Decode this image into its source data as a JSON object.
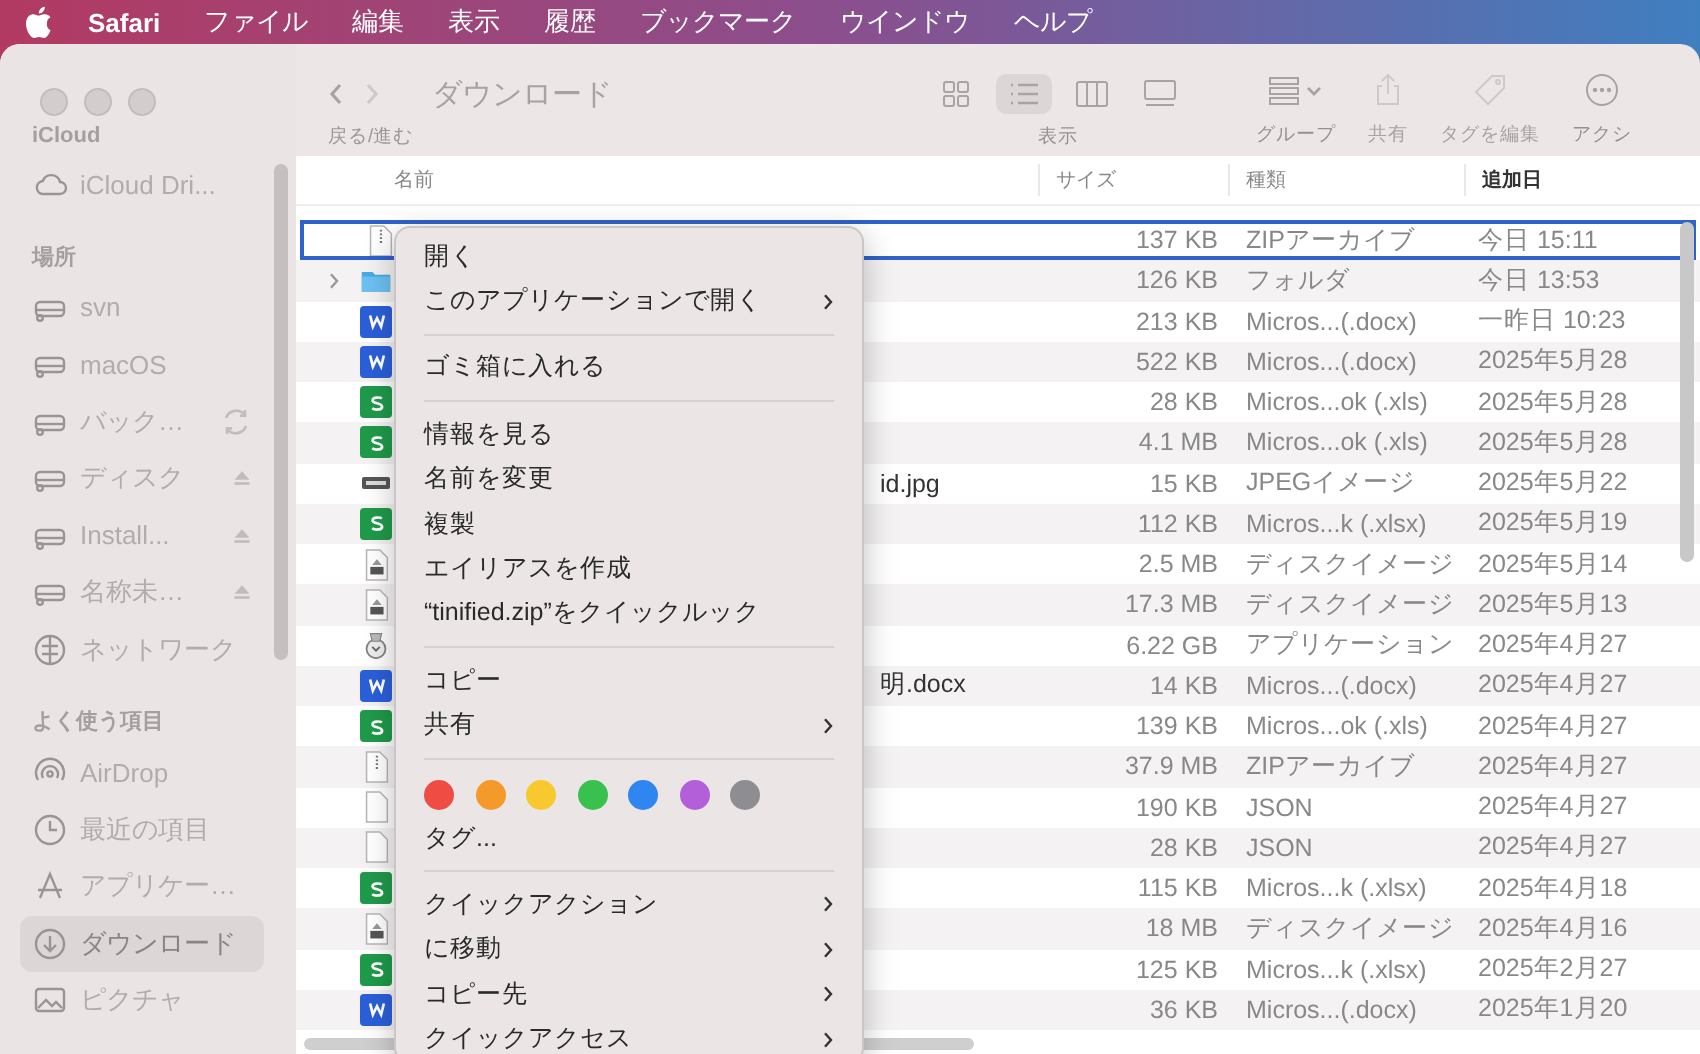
{
  "menu_bar": {
    "app": "Safari",
    "items": [
      "ファイル",
      "編集",
      "表示",
      "履歴",
      "ブックマーク",
      "ウインドウ",
      "ヘルプ"
    ]
  },
  "toolbar": {
    "title": "ダウンロード",
    "nav_label": "戻る/進む",
    "view_label": "表示",
    "views": [
      {
        "kind": "grid",
        "selected": false
      },
      {
        "kind": "list",
        "selected": true
      },
      {
        "kind": "columns",
        "selected": false
      },
      {
        "kind": "gallery",
        "selected": false
      }
    ],
    "actions": [
      {
        "kind": "group",
        "label": "グループ"
      },
      {
        "kind": "share",
        "label": "共有"
      },
      {
        "kind": "tag",
        "label": "タグを編集"
      },
      {
        "kind": "action",
        "label": "アクシ"
      }
    ]
  },
  "sidebar": {
    "sections": [
      {
        "title": "iCloud",
        "items": [
          {
            "label": "iCloud Dri...",
            "kind": "cloud",
            "selected": false
          }
        ]
      },
      {
        "title": "場所",
        "items": [
          {
            "label": "svn",
            "kind": "drive",
            "syncing": false,
            "ejectable": false,
            "selected": false
          },
          {
            "label": "macOS",
            "kind": "drive",
            "syncing": false,
            "ejectable": false,
            "selected": false
          },
          {
            "label": "バック…",
            "kind": "drive",
            "syncing": true,
            "ejectable": false,
            "selected": false
          },
          {
            "label": "ディスク",
            "kind": "drive",
            "syncing": false,
            "ejectable": true,
            "selected": false
          },
          {
            "label": "Install...",
            "kind": "drive",
            "syncing": false,
            "ejectable": true,
            "selected": false
          },
          {
            "label": "名称未…",
            "kind": "drive",
            "syncing": false,
            "ejectable": true,
            "selected": false
          },
          {
            "label": "ネットワーク",
            "kind": "network",
            "syncing": false,
            "ejectable": false,
            "selected": false
          }
        ]
      },
      {
        "title": "よく使う項目",
        "items": [
          {
            "label": "AirDrop",
            "kind": "airdrop",
            "selected": false
          },
          {
            "label": "最近の項目",
            "kind": "clock",
            "selected": false
          },
          {
            "label": "アプリケー…",
            "kind": "apps",
            "selected": false
          },
          {
            "label": "ダウンロード",
            "kind": "download",
            "selected": true
          },
          {
            "label": "ピクチャ",
            "kind": "picture",
            "selected": false
          }
        ]
      }
    ]
  },
  "table": {
    "columns": [
      {
        "label": "名前",
        "sorted": false
      },
      {
        "label": "サイズ",
        "sorted": false
      },
      {
        "label": "種類",
        "sorted": false
      },
      {
        "label": "追加日",
        "sorted": true
      }
    ],
    "rows": [
      {
        "kind": "zip",
        "size": "137 KB",
        "type": "ZIPアーカイブ",
        "date": "今日 15:11",
        "selected": true
      },
      {
        "kind": "folder",
        "size": "126 KB",
        "type": "フォルダ",
        "date": "今日 13:53",
        "selected": false
      },
      {
        "kind": "word",
        "size": "213 KB",
        "type": "Micros...(.docx)",
        "date": "一昨日 10:23",
        "selected": false
      },
      {
        "kind": "word",
        "size": "522 KB",
        "type": "Micros...(.docx)",
        "date": "2025年5月28",
        "selected": false
      },
      {
        "kind": "excel",
        "size": "28 KB",
        "type": "Micros...ok (.xls)",
        "date": "2025年5月28",
        "selected": false
      },
      {
        "kind": "excel",
        "size": "4.1 MB",
        "type": "Micros...ok (.xls)",
        "date": "2025年5月28",
        "selected": false
      },
      {
        "kind": "image",
        "name": "id.jpg",
        "size": "15 KB",
        "type": "JPEGイメージ",
        "date": "2025年5月22",
        "selected": false
      },
      {
        "kind": "excel",
        "size": "112 KB",
        "type": "Micros...k (.xlsx)",
        "date": "2025年5月19",
        "selected": false
      },
      {
        "kind": "disk",
        "size": "2.5 MB",
        "type": "ディスクイメージ",
        "date": "2025年5月14",
        "selected": false
      },
      {
        "kind": "disk",
        "size": "17.3 MB",
        "type": "ディスクイメージ",
        "date": "2025年5月13",
        "selected": false
      },
      {
        "kind": "app",
        "size": "6.22 GB",
        "type": "アプリケーション",
        "date": "2025年4月27",
        "selected": false
      },
      {
        "kind": "word",
        "name": "明.docx",
        "size": "14 KB",
        "type": "Micros...(.docx)",
        "date": "2025年4月27",
        "selected": false
      },
      {
        "kind": "excel",
        "size": "139 KB",
        "type": "Micros...ok (.xls)",
        "date": "2025年4月27",
        "selected": false
      },
      {
        "kind": "zip",
        "size": "37.9 MB",
        "type": "ZIPアーカイブ",
        "date": "2025年4月27",
        "selected": false
      },
      {
        "kind": "json",
        "size": "190 KB",
        "type": "JSON",
        "date": "2025年4月27",
        "selected": false
      },
      {
        "kind": "json",
        "size": "28 KB",
        "type": "JSON",
        "date": "2025年4月27",
        "selected": false
      },
      {
        "kind": "excel",
        "size": "115 KB",
        "type": "Micros...k (.xlsx)",
        "date": "2025年4月18",
        "selected": false
      },
      {
        "kind": "disk",
        "size": "18 MB",
        "type": "ディスクイメージ",
        "date": "2025年4月16",
        "selected": false
      },
      {
        "kind": "excel",
        "size": "125 KB",
        "type": "Micros...k (.xlsx)",
        "date": "2025年2月27",
        "selected": false
      },
      {
        "kind": "word",
        "size": "36 KB",
        "type": "Micros...(.docx)",
        "date": "2025年1月20",
        "selected": false
      }
    ]
  },
  "context_menu": [
    {
      "kind": "item",
      "label": "開く",
      "submenu": false
    },
    {
      "kind": "item",
      "label": "このアプリケーションで開く",
      "submenu": true
    },
    {
      "kind": "separator"
    },
    {
      "kind": "item",
      "label": "ゴミ箱に入れる",
      "submenu": false
    },
    {
      "kind": "separator"
    },
    {
      "kind": "item",
      "label": "情報を見る",
      "submenu": false
    },
    {
      "kind": "item",
      "label": "名前を変更",
      "submenu": false
    },
    {
      "kind": "item",
      "label": "複製",
      "submenu": false
    },
    {
      "kind": "item",
      "label": "エイリアスを作成",
      "submenu": false
    },
    {
      "kind": "item",
      "label": "“tinified.zip”をクイックルック",
      "submenu": false
    },
    {
      "kind": "separator"
    },
    {
      "kind": "item",
      "label": "コピー",
      "submenu": false
    },
    {
      "kind": "item",
      "label": "共有",
      "submenu": true
    },
    {
      "kind": "separator"
    },
    {
      "kind": "tags",
      "tags": [
        {
          "color": "#ef4c43"
        },
        {
          "color": "#f39a2b"
        },
        {
          "color": "#f7c92e"
        },
        {
          "color": "#38c14d"
        },
        {
          "color": "#2f86f0"
        },
        {
          "color": "#b25fd9"
        },
        {
          "color": "#8e8e92"
        }
      ]
    },
    {
      "kind": "item",
      "label": "タグ...",
      "submenu": false
    },
    {
      "kind": "separator"
    },
    {
      "kind": "item",
      "label": "クイックアクション",
      "submenu": true
    },
    {
      "kind": "item",
      "label": "に移動",
      "submenu": true
    },
    {
      "kind": "item",
      "label": "コピー先",
      "submenu": true
    },
    {
      "kind": "item",
      "label": "クイックアクセス",
      "submenu": true
    }
  ]
}
